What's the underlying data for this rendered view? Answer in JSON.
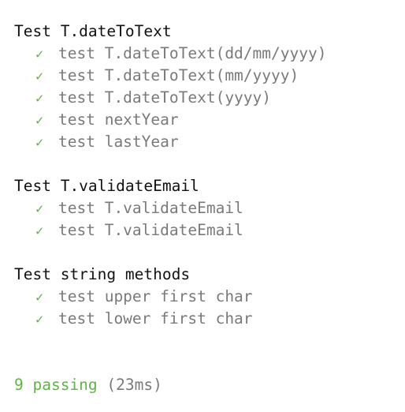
{
  "suites": [
    {
      "title": "Test T.dateToText",
      "tests": [
        {
          "icon": "checkmark-icon",
          "label": "test T.dateToText(dd/mm/yyyy)"
        },
        {
          "icon": "checkmark-icon",
          "label": "test T.dateToText(mm/yyyy)"
        },
        {
          "icon": "checkmark-icon",
          "label": "test T.dateToText(yyyy)"
        },
        {
          "icon": "checkmark-icon",
          "label": "test nextYear"
        },
        {
          "icon": "checkmark-icon",
          "label": "test lastYear"
        }
      ]
    },
    {
      "title": "Test T.validateEmail",
      "tests": [
        {
          "icon": "checkmark-icon",
          "label": "test T.validateEmail"
        },
        {
          "icon": "checkmark-icon",
          "label": "test T.validateEmail"
        }
      ]
    },
    {
      "title": "Test string methods",
      "tests": [
        {
          "icon": "checkmark-icon",
          "label": "test upper first char"
        },
        {
          "icon": "checkmark-icon",
          "label": "test lower first char"
        }
      ]
    }
  ],
  "check_glyph": "✓",
  "summary": {
    "passing": "9 passing",
    "duration": "(23ms)"
  },
  "colors": {
    "pass": "#5fb544",
    "muted": "#7a7a7a",
    "text": "#111111"
  }
}
